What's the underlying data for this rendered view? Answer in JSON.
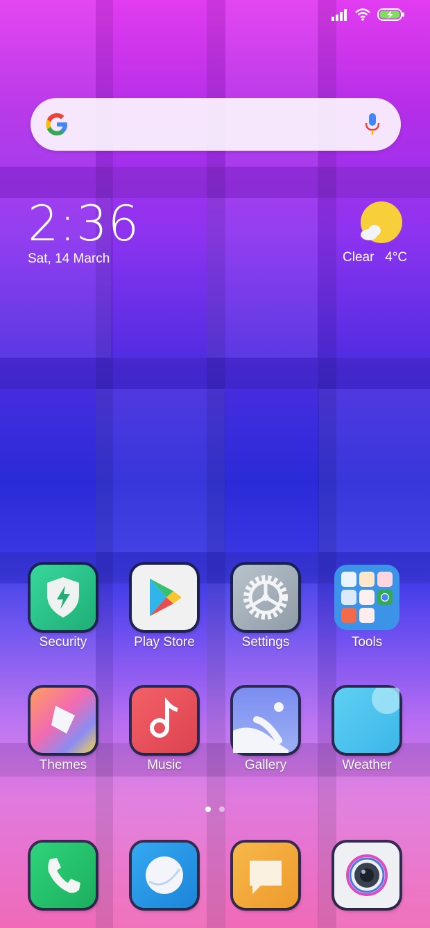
{
  "status": {
    "icons": [
      "signal-icon",
      "wifi-icon",
      "battery-charging-icon"
    ]
  },
  "search": {
    "placeholder": ""
  },
  "clock": {
    "time": "2:36",
    "date": "Sat, 14 March"
  },
  "weather": {
    "condition": "Clear",
    "temp": "4°C",
    "text": "Clear   4°C"
  },
  "apps": [
    {
      "label": "Security"
    },
    {
      "label": "Play Store"
    },
    {
      "label": "Settings"
    },
    {
      "label": "Tools"
    },
    {
      "label": "Themes"
    },
    {
      "label": "Music"
    },
    {
      "label": "Gallery"
    },
    {
      "label": "Weather"
    }
  ],
  "dock": [
    {
      "icon": "phone-icon"
    },
    {
      "icon": "browser-icon"
    },
    {
      "icon": "messages-icon"
    },
    {
      "icon": "camera-icon"
    }
  ],
  "pager": {
    "pages": 2,
    "current": 1
  },
  "colors": {
    "security": "#2bc48a",
    "music": "#e8505b",
    "weather": "#4fc3ee",
    "tools": "#3d93e8",
    "phone": "#22c26c",
    "browser": "#1f8fe0",
    "messages": "#f5a83a"
  }
}
